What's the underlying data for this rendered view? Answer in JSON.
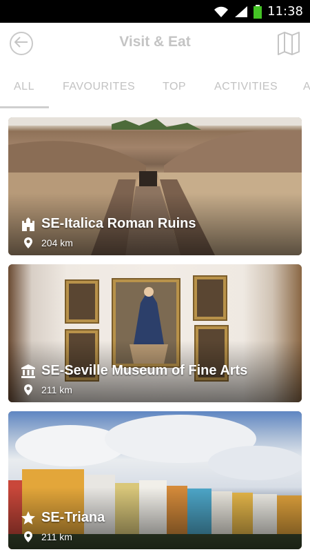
{
  "status_bar": {
    "time": "11:38"
  },
  "header": {
    "title": "Visit & Eat"
  },
  "tabs": [
    {
      "label": "ALL",
      "active": true
    },
    {
      "label": "FAVOURITES",
      "active": false
    },
    {
      "label": "TOP",
      "active": false
    },
    {
      "label": "ACTIVITIES",
      "active": false
    },
    {
      "label": "A",
      "active": false
    }
  ],
  "cards": [
    {
      "title": "SE-Italica Roman Ruins",
      "distance": "204 km",
      "icon": "castle-icon"
    },
    {
      "title": "SE-Seville Museum of Fine Arts",
      "distance": "211 km",
      "icon": "museum-icon"
    },
    {
      "title": "SE-Triana",
      "distance": "211 km",
      "icon": "star-icon"
    }
  ],
  "colors": {
    "accent_grey": "#c4c4c4",
    "status_bar": "#000000",
    "battery": "#44c425"
  }
}
